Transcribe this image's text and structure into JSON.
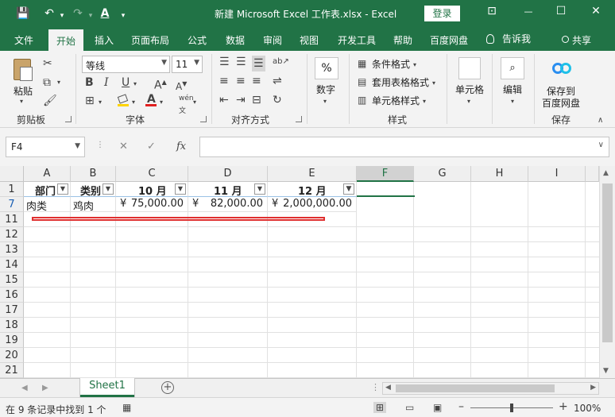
{
  "titlebar": {
    "title": "新建 Microsoft Excel 工作表.xlsx  -  Excel",
    "login_label": "登录",
    "save_glyph": "💾",
    "undo_glyph": "↶",
    "redo_glyph": "↷",
    "font_color_glyph": "A",
    "customize_glyph": "▾",
    "ribbon_opts_glyph": "⊡",
    "minimize_glyph": "—",
    "maximize_glyph": "☐",
    "close_glyph": "✕"
  },
  "tabs": [
    "文件",
    "开始",
    "插入",
    "页面布局",
    "公式",
    "数据",
    "审阅",
    "视图",
    "开发工具",
    "帮助",
    "百度网盘"
  ],
  "tell_me": "告诉我",
  "share": "共享",
  "ribbon": {
    "clipboard": {
      "paste": "粘贴",
      "group": "剪贴板"
    },
    "font": {
      "name": "等线",
      "size": "11",
      "bold": "B",
      "italic": "I",
      "underline": "U",
      "grow": "A",
      "shrink": "A",
      "group": "字体",
      "fontcolor": "A",
      "wen": "wén"
    },
    "align": {
      "group": "对齐方式"
    },
    "number": {
      "label": "数字",
      "symbol": "%"
    },
    "styles": {
      "conditional": "条件格式",
      "table": "套用表格格式",
      "cell": "单元格样式",
      "group": "样式"
    },
    "cells": {
      "label": "单元格"
    },
    "editing": {
      "label": "编辑"
    },
    "save": {
      "line1": "保存到",
      "line2": "百度网盘",
      "group": "保存"
    }
  },
  "formula": {
    "namebox": "F4",
    "cancel": "✕",
    "enter": "✓",
    "fx": "fx",
    "value": ""
  },
  "columns": [
    "A",
    "B",
    "C",
    "D",
    "E",
    "F",
    "G",
    "H",
    "I"
  ],
  "selected_column": "F",
  "rows": [
    "1",
    "7",
    "11",
    "12",
    "13",
    "14",
    "15",
    "16",
    "17",
    "18",
    "19",
    "20",
    "21"
  ],
  "table": {
    "headers": [
      "部门",
      "类别",
      "10 月",
      "11 月",
      "12 月"
    ],
    "row7": {
      "a": "肉类",
      "b": "鸡肉",
      "c": "75,000.00",
      "d": "82,000.00",
      "e": "2,000,000.00",
      "currency": "¥"
    }
  },
  "sheet": {
    "name": "Sheet1",
    "add": "+"
  },
  "status": {
    "text": "在 9 条记录中找到 1 个",
    "zoom": "100%",
    "minus": "–",
    "plus": "+"
  }
}
